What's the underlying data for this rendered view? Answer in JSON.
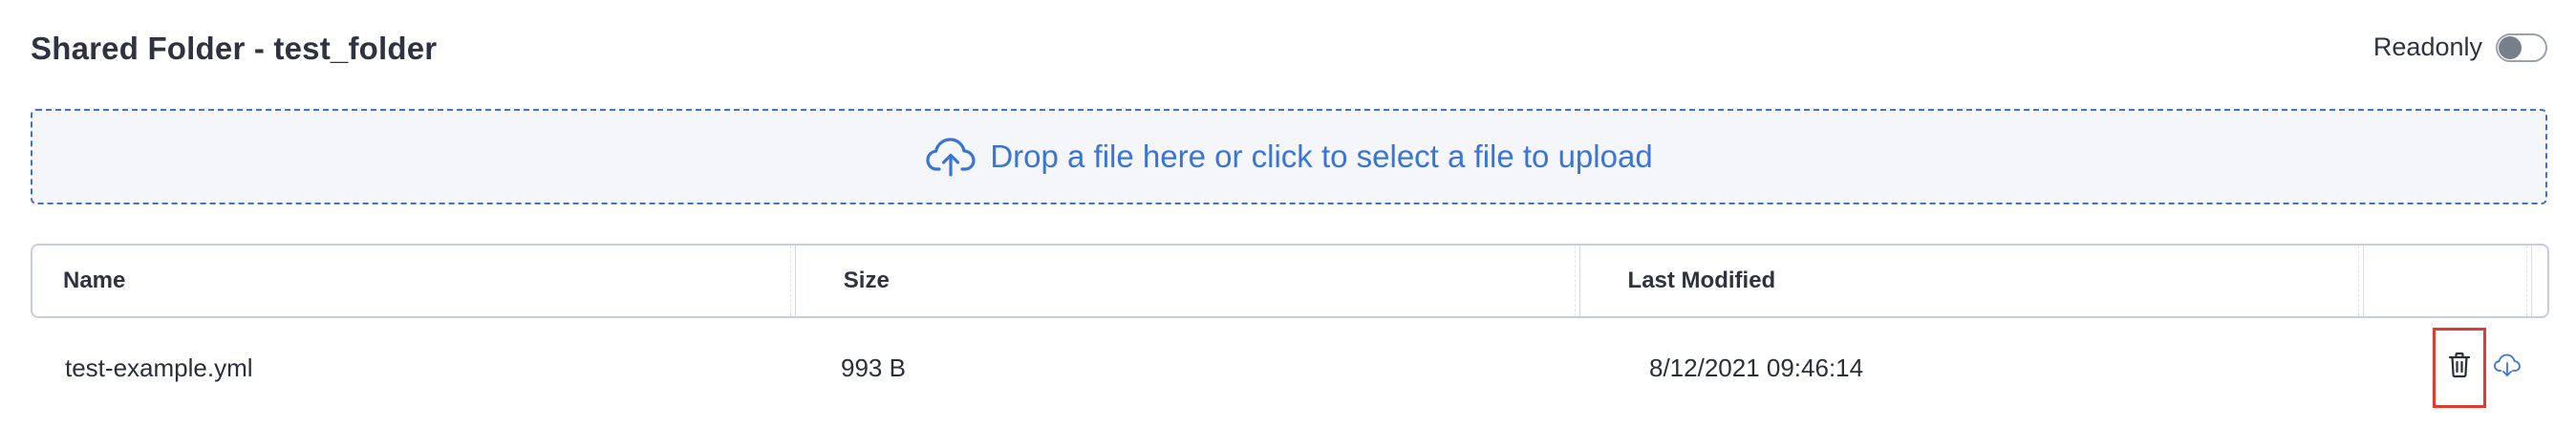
{
  "header": {
    "title": "Shared Folder - test_folder",
    "readonly_label": "Readonly",
    "readonly_on": false
  },
  "dropzone": {
    "text": "Drop a file here or click to select a file to upload",
    "icon": "cloud-upload-icon"
  },
  "table": {
    "columns": [
      "Name",
      "Size",
      "Last Modified",
      ""
    ],
    "rows": [
      {
        "name": "test-example.yml",
        "size": "993 B",
        "last_modified": "8/12/2021 09:46:14",
        "actions": [
          "trash-icon",
          "cloud-download-icon"
        ]
      }
    ]
  },
  "colors": {
    "accent": "#3a74d6",
    "highlight": "#e23a2e",
    "border": "#c7ccdf"
  }
}
